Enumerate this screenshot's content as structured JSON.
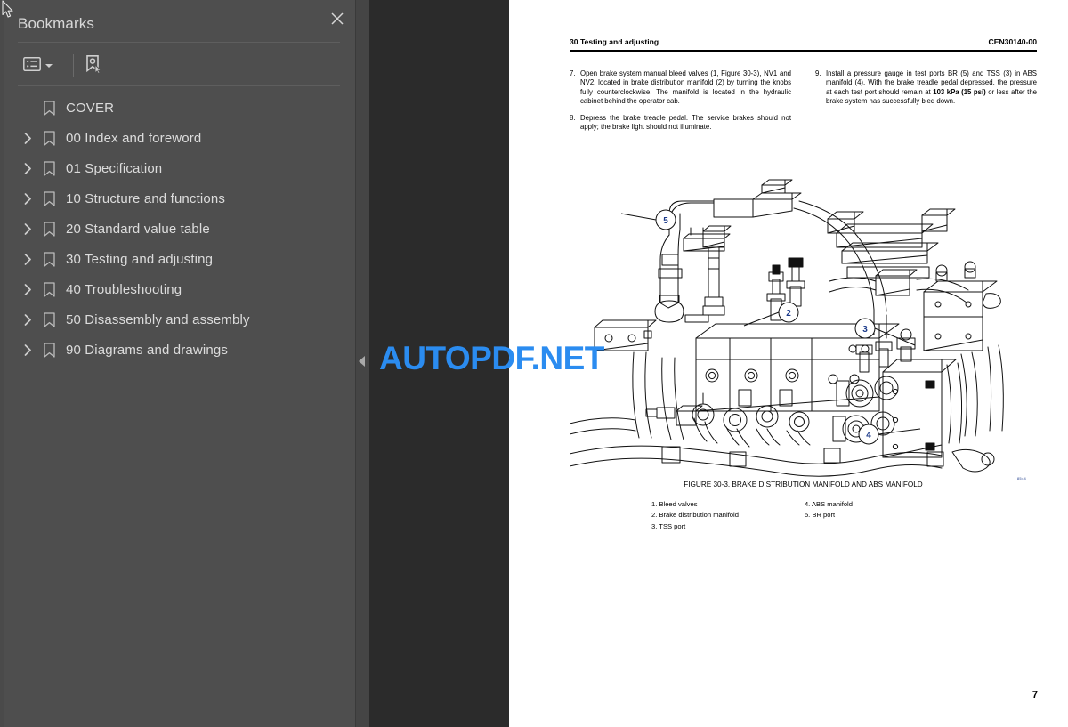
{
  "sidebar": {
    "panel_title": "Bookmarks",
    "close_icon": "close-icon",
    "toolbar": {
      "options_label": "Bookmark options",
      "new_bookmark_label": "New bookmark"
    },
    "items": [
      {
        "label": "COVER",
        "expandable": false
      },
      {
        "label": "00 Index and foreword",
        "expandable": true
      },
      {
        "label": "01 Specification",
        "expandable": true
      },
      {
        "label": "10 Structure and functions",
        "expandable": true
      },
      {
        "label": "20 Standard value table",
        "expandable": true
      },
      {
        "label": "30 Testing and adjusting",
        "expandable": true
      },
      {
        "label": "40 Troubleshooting",
        "expandable": true
      },
      {
        "label": "50 Disassembly and assembly",
        "expandable": true
      },
      {
        "label": "90 Diagrams and drawings",
        "expandable": true
      }
    ]
  },
  "viewer": {
    "collapse_handle_label": "Collapse sidebar",
    "watermark": {
      "part1": "AUTOP",
      "part2": "DF.",
      "part3": "NET"
    }
  },
  "document": {
    "header_left": "30 Testing and adjusting",
    "header_right": "CEN30140-00",
    "page_number": "7",
    "columns": [
      {
        "steps": [
          {
            "num": "7.",
            "text": "Open brake system manual bleed valves (1, Figure 30-3), NV1 and NV2, located in brake distribution manifold (2) by turning the knobs fully counterclockwise. The manifold is located in the hydraulic cabinet behind the operator cab."
          },
          {
            "num": "8.",
            "text": "Depress the brake treadle pedal. The service brakes should not apply; the brake light should not illuminate."
          }
        ]
      },
      {
        "steps": [
          {
            "num": "9.",
            "text_before": "Install a pressure gauge in test ports BR (5) and TSS (3) in ABS manifold (4). With the brake treadle pedal depressed, the pressure at each test port should remain at ",
            "bold": "103 kPa (15 psi)",
            "text_after": " or less after the brake system has successfully bled down."
          }
        ]
      }
    ],
    "figure": {
      "caption": "FIGURE 30-3. BRAKE DISTRIBUTION MANIFOLD AND ABS MANIFOLD",
      "id_mark": "8544",
      "callouts": [
        "5",
        "2",
        "3",
        "4"
      ],
      "legend_left": "1. Bleed valves\n2. Brake distribution manifold\n3. TSS port",
      "legend_right": "4. ABS manifold\n5. BR port"
    }
  }
}
